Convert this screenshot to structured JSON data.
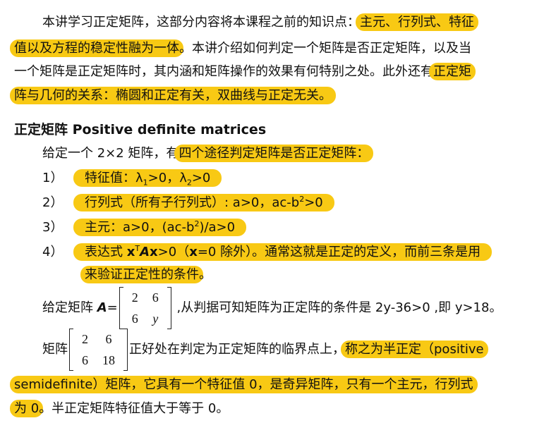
{
  "intro": {
    "l1_plain": "本讲学习正定矩阵，这部分内容将本课程之前的知识点：",
    "l1_hl": "主元、行列式、特征",
    "l2_hl": "值以及方程的稳定性融为一体",
    "l2_plain": "。本讲介绍如何判定一个矩阵是否正定矩阵，以及当",
    "l3_plain": "一个矩阵是正定矩阵时，其内涵和矩阵操作的效果有何特别之处。此外还有",
    "l3_hl": "正定矩",
    "l4_hl": "阵与几何的关系：椭圆和正定有关，双曲线与正定无关。"
  },
  "heading": "正定矩阵 Positive definite matrices",
  "given": {
    "plain": "给定一个 2×2 矩阵，有",
    "hl": "四个途径判定矩阵是否正定矩阵："
  },
  "tests": [
    {
      "num": "1）",
      "pre": "特征值：λ",
      "s1": "1",
      "mid": ">0，λ",
      "s2": "2",
      "post": ">0"
    },
    {
      "num": "2）",
      "pre": "行列式（所有子行列式）: a>0，ac-b",
      "sup": "2",
      "post": ">0"
    },
    {
      "num": "3）",
      "pre": "主元：a>0，(ac-b",
      "sup": "2",
      "post": ")/a>0"
    },
    {
      "num": "4）",
      "label": "表达式 ",
      "x1": "x",
      "t": "T",
      "A": "A",
      "x2": "x",
      "rest1": ">0（",
      "x3": "x",
      "rest2": "=0  除外）",
      "tail": "。通常这就是正定的定义，而前三条是用",
      "cont": "来验证正定性的条件"
    }
  ],
  "example1": {
    "pre": "给定矩阵 ",
    "Aname": "A",
    "eq": "=",
    "m": [
      [
        "2",
        "6"
      ],
      [
        "6",
        "y"
      ]
    ],
    "post": " ,从判据可知矩阵为正定阵的条件是 2y-36>0 ,即 y>18。"
  },
  "example2": {
    "pre": "矩阵",
    "m": [
      [
        "2",
        "6"
      ],
      [
        "6",
        "18"
      ]
    ],
    "plain": "正好处在判定为正定矩阵的临界点上，",
    "hl": "称之为半正定（positive",
    "l2_hl": "semidefinite）矩阵，它具有一个特征值 0，是奇异矩阵，只有一个主元，行列式",
    "l3_hl": "为 0",
    "l3_plain": "。半正定矩阵特征值大于等于 0。"
  },
  "colors": {
    "highlight": "#f8c914",
    "text": "#111111"
  }
}
